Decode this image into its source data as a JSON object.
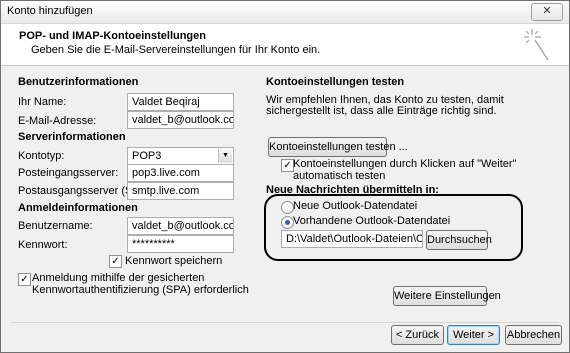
{
  "window": {
    "title": "Konto hinzufügen",
    "close_label": "✕"
  },
  "header": {
    "title": "POP- und IMAP-Kontoeinstellungen",
    "subtitle": "Geben Sie die E-Mail-Servereinstellungen für Ihr Konto ein."
  },
  "user_info": {
    "section": "Benutzerinformationen",
    "name_label": "Ihr Name:",
    "name_value": "Valdet Beqiraj",
    "email_label": "E-Mail-Adresse:",
    "email_value": "valdet_b@outlook.com"
  },
  "server_info": {
    "section": "Serverinformationen",
    "type_label": "Kontotyp:",
    "type_value": "POP3",
    "incoming_label": "Posteingangsserver:",
    "incoming_value": "pop3.live.com",
    "outgoing_label": "Postausgangsserver (SMTP):",
    "outgoing_value": "smtp.live.com"
  },
  "login_info": {
    "section": "Anmeldeinformationen",
    "user_label": "Benutzername:",
    "user_value": "valdet_b@outlook.com",
    "pass_label": "Kennwort:",
    "pass_value": "**********",
    "remember_label": "Kennwort speichern",
    "spa_label_1": "Anmeldung mithilfe der gesicherten",
    "spa_label_2": "Kennwortauthentifizierung (SPA) erforderlich"
  },
  "test": {
    "section": "Kontoeinstellungen testen",
    "text_1": "Wir empfehlen Ihnen, das Konto zu testen, damit",
    "text_2": "sichergestellt ist, dass alle Einträge richtig sind.",
    "button": "Kontoeinstellungen testen ...",
    "auto_label_1": "Kontoeinstellungen durch Klicken auf \"Weiter\"",
    "auto_label_2": "automatisch testen"
  },
  "deliver": {
    "section": "Neue Nachrichten übermitteln in:",
    "new_label": "Neue Outlook-Datendatei",
    "existing_label": "Vorhandene Outlook-Datendatei",
    "path_value": "D:\\Valdet\\Outlook-Dateien\\Outlook",
    "browse_button": "Durchsuchen"
  },
  "more_settings_button": "Weitere Einstellungen",
  "footer": {
    "back": "< Zurück",
    "next": "Weiter >",
    "cancel": "Abbrechen"
  },
  "colors": {
    "accent": "#2a5db0",
    "ellipse": "#000000"
  }
}
